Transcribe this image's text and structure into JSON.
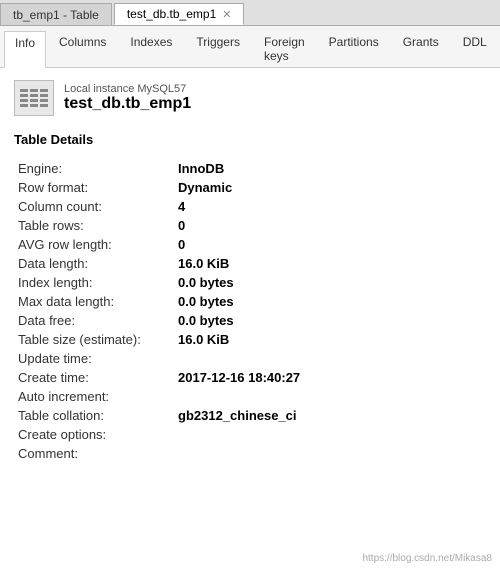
{
  "tabs": {
    "tab1": {
      "label": "tb_emp1 - Table",
      "active": false
    },
    "tab2": {
      "label": "test_db.tb_emp1",
      "active": true,
      "closable": true
    }
  },
  "nav_tabs": [
    {
      "label": "Info",
      "active": true
    },
    {
      "label": "Columns",
      "active": false
    },
    {
      "label": "Indexes",
      "active": false
    },
    {
      "label": "Triggers",
      "active": false
    },
    {
      "label": "Foreign keys",
      "active": false
    },
    {
      "label": "Partitions",
      "active": false
    },
    {
      "label": "Grants",
      "active": false
    },
    {
      "label": "DDL",
      "active": false
    }
  ],
  "header": {
    "instance_label": "Local instance MySQL57",
    "table_name": "test_db.tb_emp1"
  },
  "section_title": "Table Details",
  "fields": [
    {
      "label": "Engine:",
      "value": "InnoDB",
      "has_value": true
    },
    {
      "label": "Row format:",
      "value": "Dynamic",
      "has_value": true
    },
    {
      "label": "Column count:",
      "value": "4",
      "has_value": true
    },
    {
      "label": "Table rows:",
      "value": "0",
      "has_value": true
    },
    {
      "label": "AVG row length:",
      "value": "0",
      "has_value": true
    },
    {
      "label": "Data length:",
      "value": "16.0 KiB",
      "has_value": true
    },
    {
      "label": "Index length:",
      "value": "0.0 bytes",
      "has_value": true
    },
    {
      "label": "Max data length:",
      "value": "0.0 bytes",
      "has_value": true
    },
    {
      "label": "Data free:",
      "value": "0.0 bytes",
      "has_value": true
    },
    {
      "label": "Table size (estimate):",
      "value": "16.0 KiB",
      "has_value": true
    },
    {
      "label": "Update time:",
      "value": "",
      "has_value": false
    },
    {
      "label": "Create time:",
      "value": "2017-12-16 18:40:27",
      "has_value": true
    },
    {
      "label": "Auto increment:",
      "value": "",
      "has_value": false
    },
    {
      "label": "Table collation:",
      "value": "gb2312_chinese_ci",
      "has_value": true
    },
    {
      "label": "Create options:",
      "value": "",
      "has_value": false
    },
    {
      "label": "Comment:",
      "value": "",
      "has_value": false
    }
  ],
  "watermark": "https://blog.csdn.net/Mikasa8"
}
